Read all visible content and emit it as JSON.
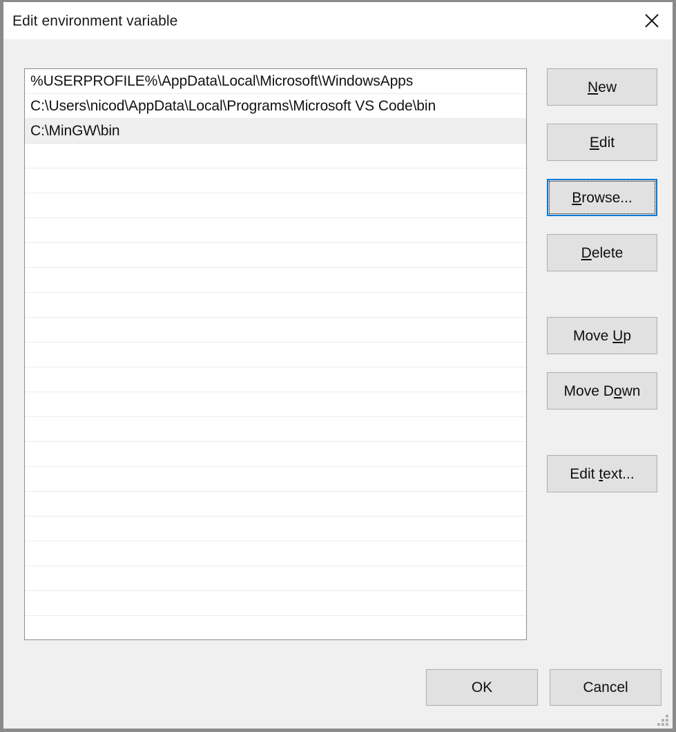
{
  "window": {
    "title": "Edit environment variable",
    "close_icon": "close-icon",
    "body_background": "#f0f0f0",
    "titlebar_background": "#ffffff",
    "border_color": "#8a8a8a"
  },
  "path_list": {
    "entries": [
      {
        "value": "%USERPROFILE%\\AppData\\Local\\Microsoft\\WindowsApps",
        "highlighted": false
      },
      {
        "value": "C:\\Users\\nicod\\AppData\\Local\\Programs\\Microsoft VS Code\\bin",
        "highlighted": false
      },
      {
        "value": "C:\\MinGW\\bin",
        "highlighted": true
      }
    ],
    "empty_row_count": 20,
    "background": "#ffffff",
    "highlight_color": "#efefef",
    "border_color": "#888d93",
    "separator_color": "#ececec"
  },
  "side_buttons": [
    {
      "label_before": "",
      "mnemonic": "N",
      "label_after": "ew",
      "name": "new-button",
      "focused": false
    },
    {
      "label_before": "",
      "mnemonic": "E",
      "label_after": "dit",
      "name": "edit-button",
      "focused": false
    },
    {
      "label_before": "",
      "mnemonic": "B",
      "label_after": "rowse...",
      "name": "browse-button",
      "focused": true
    },
    {
      "label_before": "",
      "mnemonic": "D",
      "label_after": "elete",
      "name": "delete-button",
      "focused": false
    },
    {
      "label_before": "Move ",
      "mnemonic": "U",
      "label_after": "p",
      "name": "move-up-button",
      "focused": false
    },
    {
      "label_before": "Move D",
      "mnemonic": "o",
      "label_after": "wn",
      "name": "move-down-button",
      "focused": false
    },
    {
      "label_before": "Edit ",
      "mnemonic": "t",
      "label_after": "ext...",
      "name": "edit-text-button",
      "focused": false
    }
  ],
  "bottom_buttons": {
    "ok_label": "OK",
    "cancel_label": "Cancel"
  },
  "colors": {
    "button_face": "#e1e1e1",
    "button_border": "#adadad",
    "focus_blue": "#0078d7",
    "text": "#0f0f0f"
  }
}
